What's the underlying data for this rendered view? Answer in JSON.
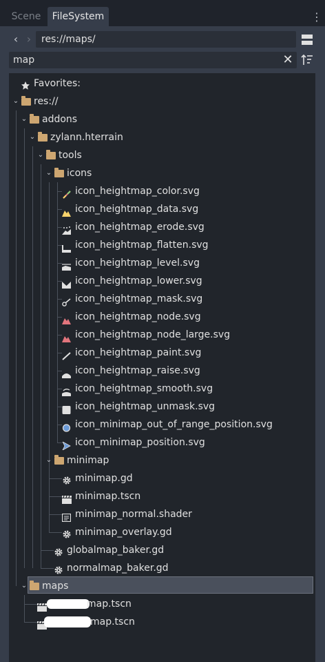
{
  "tabs": [
    {
      "label": "Scene",
      "active": false
    },
    {
      "label": "FileSystem",
      "active": true
    }
  ],
  "path": "res://maps/",
  "search": {
    "value": "map"
  },
  "tree": {
    "favorites": "Favorites:",
    "root": "res://",
    "addons": "addons",
    "zylann": "zylann.hterrain",
    "tools": "tools",
    "icons": "icons",
    "icon_files": [
      "icon_heightmap_color.svg",
      "icon_heightmap_data.svg",
      "icon_heightmap_erode.svg",
      "icon_heightmap_flatten.svg",
      "icon_heightmap_level.svg",
      "icon_heightmap_lower.svg",
      "icon_heightmap_mask.svg",
      "icon_heightmap_node.svg",
      "icon_heightmap_node_large.svg",
      "icon_heightmap_paint.svg",
      "icon_heightmap_raise.svg",
      "icon_heightmap_smooth.svg",
      "icon_heightmap_unmask.svg",
      "icon_minimap_out_of_range_position.svg",
      "icon_minimap_position.svg"
    ],
    "minimap": "minimap",
    "minimap_files": [
      "minimap.gd",
      "minimap.tscn",
      "minimap_normal.shader",
      "minimap_overlay.gd"
    ],
    "tools_files": [
      "globalmap_baker.gd",
      "normalmap_baker.gd"
    ],
    "maps": "maps",
    "maps_files": [
      "map.tscn",
      "map.tscn"
    ]
  },
  "colors": {
    "folder": "#cda671",
    "accent": "#6c9bd8",
    "pink": "#e2757d",
    "yellow": "#f6d26b"
  }
}
